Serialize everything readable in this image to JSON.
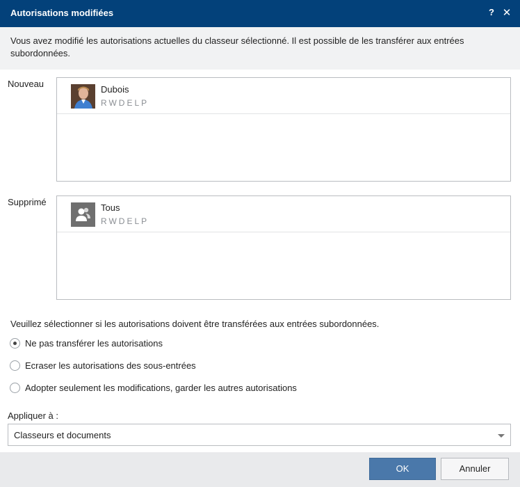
{
  "dialog": {
    "title": "Autorisations modifiées",
    "help_label": "?",
    "close_label": "✕"
  },
  "info": {
    "message": "Vous avez modifié les autorisations actuelles du classeur sélectionné. Il est possible de les transférer aux entrées subordonnées."
  },
  "new_section": {
    "label": "Nouveau",
    "entries": [
      {
        "name": "Dubois",
        "rights": "RWDELP",
        "icon": "user-photo-icon"
      }
    ]
  },
  "deleted_section": {
    "label": "Supprimé",
    "entries": [
      {
        "name": "Tous",
        "rights": "RWDELP",
        "icon": "group-icon"
      }
    ]
  },
  "transfer": {
    "question": "Veuillez sélectionner si les autorisations doivent être transférées aux entrées subordonnées.",
    "options": [
      {
        "label": "Ne pas transférer les autorisations",
        "selected": true
      },
      {
        "label": "Ecraser les autorisations des sous-entrées",
        "selected": false
      },
      {
        "label": "Adopter seulement les modifications, garder les autres autorisations",
        "selected": false
      }
    ]
  },
  "apply": {
    "label": "Appliquer à :",
    "selected_value": "Classeurs et documents"
  },
  "footer": {
    "ok_label": "OK",
    "cancel_label": "Annuler"
  },
  "colors": {
    "titlebar": "#03417a",
    "primary_button": "#4a78aa",
    "info_background": "#f1f2f3",
    "footer_background": "#e9eaec"
  }
}
